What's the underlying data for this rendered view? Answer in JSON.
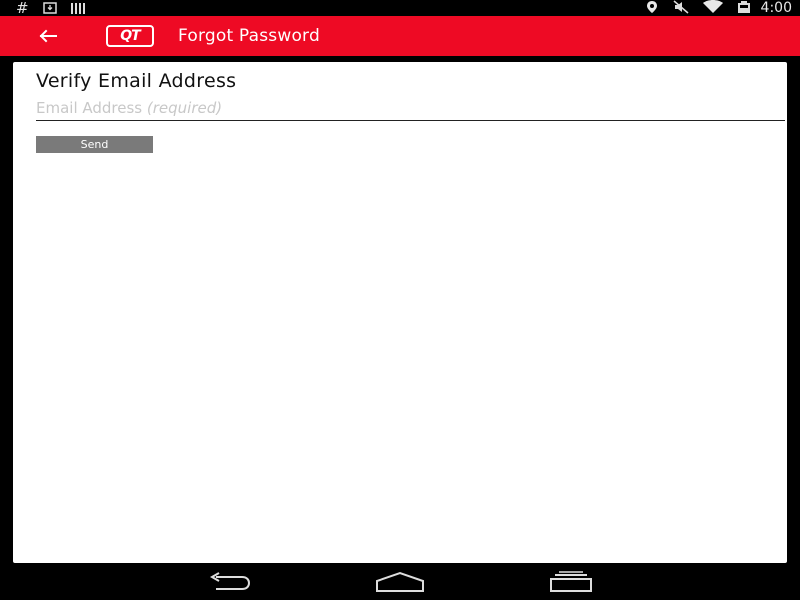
{
  "status_bar": {
    "left_icons": [
      "hash-icon",
      "download-icon",
      "signal-bars-icon"
    ],
    "hash_glyph": "#",
    "right_icons": [
      "location-icon",
      "mute-icon",
      "wifi-icon",
      "battery-icon"
    ],
    "time": "4:00"
  },
  "app_bar": {
    "title": "Forgot Password",
    "logo_text": "QT",
    "back_icon": "arrow-left-icon",
    "background": "#ee0a24"
  },
  "form": {
    "heading": "Verify Email Address",
    "email": {
      "value": "",
      "placeholder": "Email Address",
      "placeholder_hint": "(required)"
    },
    "send_label": "Send"
  },
  "nav_bar": {
    "buttons": [
      "back-nav-icon",
      "home-nav-icon",
      "recents-nav-icon"
    ]
  }
}
